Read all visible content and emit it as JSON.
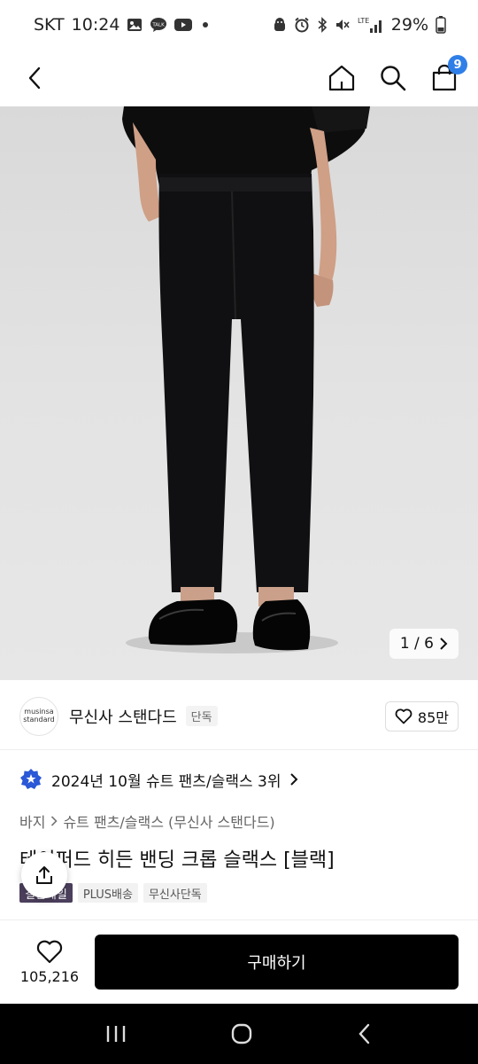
{
  "status_bar": {
    "carrier": "SKT",
    "time": "10:24",
    "network": "LTE",
    "battery": "29%"
  },
  "header": {
    "cart_count": "9"
  },
  "image": {
    "counter_text": "1 / 6"
  },
  "brand": {
    "logo_line1": "musinsa",
    "logo_line2": "standard",
    "name": "무신사 스탠다드",
    "tag": "단독",
    "likes": "85만"
  },
  "rank": {
    "text": "2024년 10월 슈트 팬츠/슬랙스 3위"
  },
  "breadcrumb": {
    "level1": "바지",
    "level2": "슈트 팬츠/슬랙스 (무신사 스탠다드)"
  },
  "product": {
    "title": "테이퍼드 히든 밴딩 크롭 슬랙스 [블랙]",
    "tags": [
      "결산세일",
      "PLUS배송",
      "무신사단독"
    ]
  },
  "bottom": {
    "wish_count": "105,216",
    "buy_label": "구매하기"
  },
  "colors": {
    "badge": "#2f7fe8",
    "buy": "#000000",
    "tag_dark": "#4b3f5c"
  },
  "icons": [
    "back-icon",
    "home-icon",
    "search-icon",
    "bag-icon",
    "heart-icon",
    "chevron-right-icon",
    "rank-badge-icon",
    "share-icon"
  ]
}
